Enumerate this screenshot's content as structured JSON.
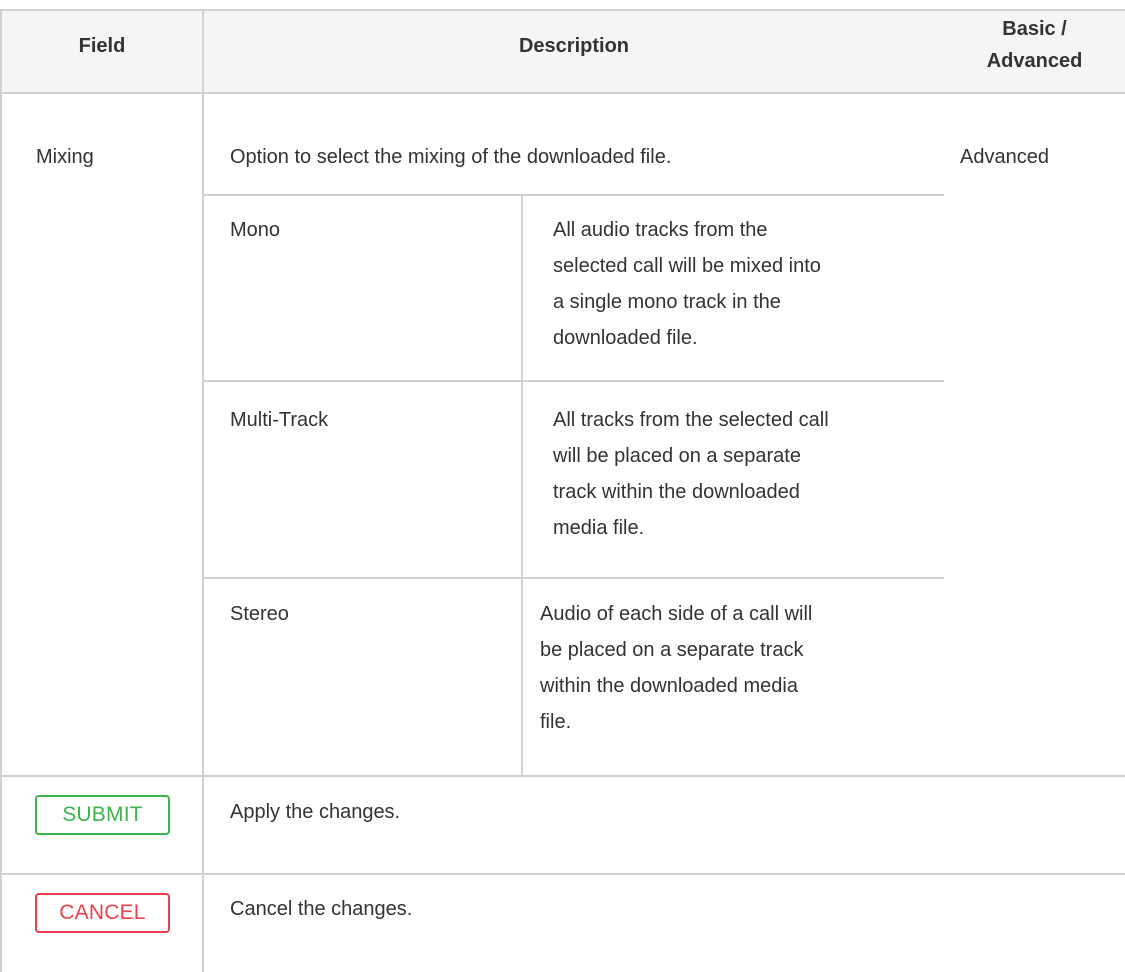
{
  "header": {
    "field": "Field",
    "description": "Description",
    "level_line1": "Basic /",
    "level_line2": "Advanced"
  },
  "mixing_row": {
    "field": "Mixing",
    "description": "Option to select the mixing of the downloaded file.",
    "level": "Advanced",
    "options": [
      {
        "name": "Mono",
        "lines": [
          "All audio tracks from the",
          "selected call will be mixed into",
          "a single mono track in the",
          "downloaded file."
        ]
      },
      {
        "name": "Multi-Track",
        "lines": [
          "All tracks from the selected call",
          "will be placed on a separate",
          "track within the downloaded",
          "media file."
        ]
      },
      {
        "name": "Stereo",
        "lines": [
          "Audio of each side of a call will",
          "be placed on a separate track",
          "within the downloaded media",
          "file."
        ]
      }
    ]
  },
  "submit_row": {
    "button_label": "SUBMIT",
    "description": "Apply the changes.",
    "button_color": "#3cb44b"
  },
  "cancel_row": {
    "button_label": "CANCEL",
    "description": "Cancel the changes.",
    "button_color": "#e8414e"
  },
  "colors": {
    "header_bg": "#f5f5f5",
    "border": "#d2d2d2",
    "text": "#333333"
  }
}
